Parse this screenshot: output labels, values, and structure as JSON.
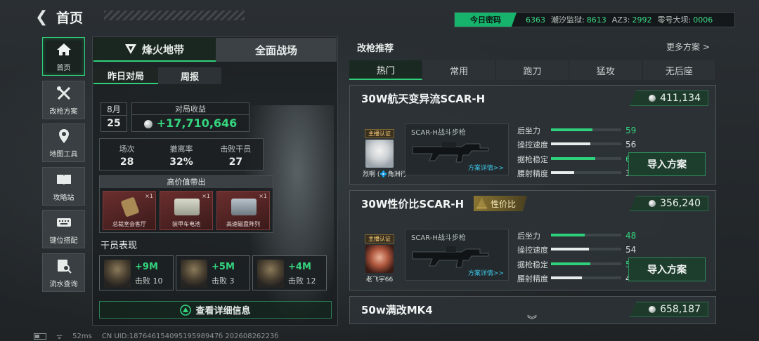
{
  "header": {
    "back_icon": "back-arrow-icon",
    "title": "首页"
  },
  "codebar": {
    "tag": "今日密码",
    "codes": [
      {
        "label": "",
        "value": "6363"
      },
      {
        "label": "潮汐监狱:",
        "value": "8613"
      },
      {
        "label": "AZ3:",
        "value": "2992"
      },
      {
        "label": "零号大坝:",
        "value": "0006"
      }
    ]
  },
  "sidebar": {
    "items": [
      {
        "label": "首页",
        "icon": "home-icon",
        "active": true
      },
      {
        "label": "改枪方案",
        "icon": "tools-icon",
        "active": false
      },
      {
        "label": "地图工具",
        "icon": "map-pin-icon",
        "active": false
      },
      {
        "label": "攻略站",
        "icon": "book-icon",
        "active": false
      },
      {
        "label": "键位搭配",
        "icon": "keyboard-icon",
        "active": false
      },
      {
        "label": "流水查询",
        "icon": "search-record-icon",
        "active": false
      }
    ]
  },
  "left": {
    "mode_tabs": [
      "烽火地带",
      "全面战场"
    ],
    "sub_tabs": [
      "昨日对局",
      "周报"
    ],
    "month": "8月",
    "day": "25",
    "income_label": "对局收益",
    "income_value": "+17,710,646",
    "stats": [
      {
        "label": "场次",
        "value": "28"
      },
      {
        "label": "撤离率",
        "value": "32%"
      },
      {
        "label": "击败干员",
        "value": "27"
      }
    ],
    "high_value_title": "高价值带出",
    "high_value_items": [
      {
        "name": "总裁室会客厅",
        "count": "×1",
        "color": "#a88a55"
      },
      {
        "name": "装甲车电池",
        "count": "×1",
        "color": "#c9cbbf"
      },
      {
        "name": "高速磁盘阵列",
        "count": "×1",
        "color": "#8f9aa3"
      }
    ],
    "performance_title": "干员表现",
    "performance": [
      {
        "value": "+9M",
        "kills": "击败 10"
      },
      {
        "value": "+5M",
        "kills": "击败 3"
      },
      {
        "value": "+4M",
        "kills": "击败 12"
      }
    ],
    "detail_button": "查看详细信息"
  },
  "right": {
    "title": "改枪推荐",
    "more": "更多方案 >",
    "tabs": [
      "热门",
      "常用",
      "跑刀",
      "猛攻",
      "无后座"
    ],
    "active_tab": 0,
    "cards": [
      {
        "name": "30W航天变异流SCAR-H",
        "price": "411,134",
        "badge": "",
        "streamer_label": "主播认证",
        "streamer_name": "烈啊 (💠角洲行",
        "gun_name": "SCAR-H战斗步枪",
        "gun_detail": "方案详情>>",
        "stats": [
          {
            "label": "后坐力",
            "value": 59,
            "color": "#2fd07b"
          },
          {
            "label": "操控速度",
            "value": 56,
            "color": "#e8ecea"
          },
          {
            "label": "据枪稳定",
            "value": 63,
            "color": "#2fd07b"
          },
          {
            "label": "腰射精度",
            "value": 33,
            "color": "#e8ecea"
          }
        ],
        "import": "导入方案"
      },
      {
        "name": "30W性价比SCAR-H",
        "price": "356,240",
        "badge": "性价比",
        "streamer_label": "主播认证",
        "streamer_name": "老飞宇66",
        "gun_name": "SCAR-H战斗步枪",
        "gun_detail": "方案详情>>",
        "stats": [
          {
            "label": "后坐力",
            "value": 48,
            "color": "#2fd07b"
          },
          {
            "label": "操控速度",
            "value": 54,
            "color": "#e8ecea"
          },
          {
            "label": "据枪稳定",
            "value": 56,
            "color": "#2fd07b"
          },
          {
            "label": "腰射精度",
            "value": 44,
            "color": "#e8ecea"
          }
        ],
        "import": "导入方案"
      },
      {
        "name": "50w满改MK4",
        "price": "658,187"
      }
    ]
  },
  "status": {
    "ping": "52ms",
    "uid": "CN UID:18764615409519598947б 20260826223б"
  }
}
